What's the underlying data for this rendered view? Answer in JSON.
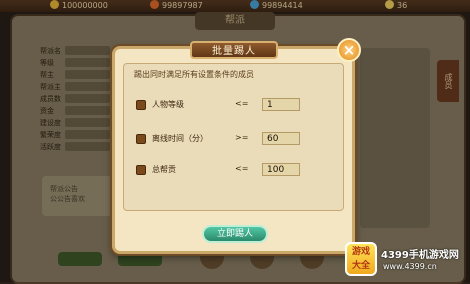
{
  "topbar": {
    "resources": [
      {
        "value": "100000000",
        "icon": "coin-icon",
        "color": "#e8b93a"
      },
      {
        "value": "99897987",
        "icon": "ingot-icon",
        "color": "#e06b2a"
      },
      {
        "value": "99894414",
        "icon": "gem-icon",
        "color": "#4aa3d8"
      },
      {
        "value": "36",
        "icon": "star-icon",
        "color": "#f0d060"
      }
    ]
  },
  "background_panel": {
    "title": "帮派",
    "form_labels": [
      "帮派名",
      "等级",
      "帮主",
      "帮派主",
      "成员数",
      "资金",
      "建设度",
      "繁荣度",
      "活跃度"
    ],
    "notice_label": "帮派公告",
    "notice_text": "公公告喜欢",
    "side_tab": "成员"
  },
  "dialog": {
    "title": "批量踢人",
    "hint": "踢出同时满足所有设置条件的成员",
    "conditions": [
      {
        "label": "人物等级",
        "operator": "<=",
        "value": "1"
      },
      {
        "label": "离线时间（分）",
        "operator": ">=",
        "value": "60"
      },
      {
        "label": "总帮贡",
        "operator": "<=",
        "value": "100"
      }
    ],
    "kick_button": "立即踢人",
    "close_label": "×"
  },
  "watermark": {
    "badge": "游戏\n大全",
    "name": "4399手机游戏网",
    "url": "www.4399.cn"
  },
  "colors": {
    "accent": "#c9a86a",
    "button": "#2a8a6b",
    "checkbox": "#7b4a1c"
  }
}
